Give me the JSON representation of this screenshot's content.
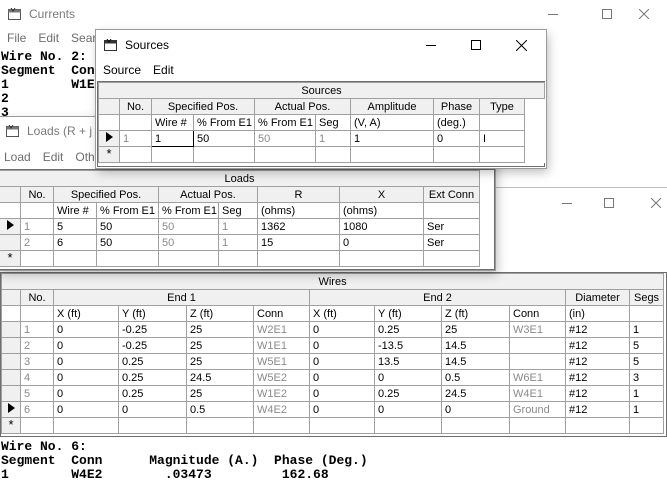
{
  "currents_window": {
    "title": "Currents",
    "menu": [
      "File",
      "Edit",
      "Searc"
    ],
    "lines_top": [
      "Wire No. 2:",
      "Segment  Con",
      "1        W1E",
      "2",
      "3"
    ],
    "lines_bottom": [
      "Wire No. 6:",
      "Segment  Conn      Magnitude (A.)  Phase (Deg.)",
      "1        W4E2        .03473         162.68"
    ]
  },
  "sources_window": {
    "title": "Sources",
    "menu": [
      "Source",
      "Edit"
    ],
    "caption": "Sources",
    "headers": {
      "no": "No.",
      "specified": "Specified Pos.",
      "actual": "Actual Pos.",
      "amplitude": "Amplitude",
      "phase": "Phase",
      "type": "Type"
    },
    "subheaders": {
      "wire": "Wire #",
      "from1": "% From E1",
      "from2": "% From E1",
      "seg": "Seg",
      "amp_units": "(V, A)",
      "phase_units": "(deg.)"
    },
    "rows": [
      {
        "no": "1",
        "wire": "1",
        "from": "50",
        "afrom": "50",
        "seg": "1",
        "amp": "1",
        "phase": "0",
        "type": "I"
      }
    ],
    "new_row_marker": "*"
  },
  "loads_window": {
    "title": "Loads (R + j X",
    "menu": [
      "Load",
      "Edit",
      "Oth"
    ],
    "caption": "Loads",
    "headers": {
      "no": "No.",
      "specified": "Specified Pos.",
      "actual": "Actual Pos.",
      "r": "R",
      "x": "X",
      "ext": "Ext Conn"
    },
    "subheaders": {
      "wire": "Wire #",
      "from1": "% From E1",
      "from2": "% From E1",
      "seg": "Seg",
      "r_units": "(ohms)",
      "x_units": "(ohms)"
    },
    "rows": [
      {
        "no": "1",
        "wire": "5",
        "from": "50",
        "afrom": "50",
        "seg": "1",
        "r": "1362",
        "x": "1080",
        "ext": "Ser"
      },
      {
        "no": "2",
        "wire": "6",
        "from": "50",
        "afrom": "50",
        "seg": "1",
        "r": "15",
        "x": "0",
        "ext": "Ser"
      }
    ],
    "new_row_marker": "*"
  },
  "wires_window": {
    "caption": "Wires",
    "headers": {
      "no": "No.",
      "end1": "End 1",
      "end2": "End 2",
      "diameter": "Diameter",
      "segs": "Segs"
    },
    "subheaders": {
      "x1": "X  (ft)",
      "y1": "Y  (ft)",
      "z1": "Z  (ft)",
      "conn1": "Conn",
      "x2": "X  (ft)",
      "y2": "Y  (ft)",
      "z2": "Z  (ft)",
      "conn2": "Conn",
      "dia_units": "(in)"
    },
    "rows": [
      {
        "no": "1",
        "x1": "0",
        "y1": "-0.25",
        "z1": "25",
        "c1": "W2E1",
        "x2": "0",
        "y2": "0.25",
        "z2": "25",
        "c2": "W3E1",
        "dia": "#12",
        "segs": "1"
      },
      {
        "no": "2",
        "x1": "0",
        "y1": "-0.25",
        "z1": "25",
        "c1": "W1E1",
        "x2": "0",
        "y2": "-13.5",
        "z2": "14.5",
        "c2": "",
        "dia": "#12",
        "segs": "5"
      },
      {
        "no": "3",
        "x1": "0",
        "y1": "0.25",
        "z1": "25",
        "c1": "W5E1",
        "x2": "0",
        "y2": "13.5",
        "z2": "14.5",
        "c2": "",
        "dia": "#12",
        "segs": "5"
      },
      {
        "no": "4",
        "x1": "0",
        "y1": "0.25",
        "z1": "24.5",
        "c1": "W5E2",
        "x2": "0",
        "y2": "0",
        "z2": "0.5",
        "c2": "W6E1",
        "dia": "#12",
        "segs": "3"
      },
      {
        "no": "5",
        "x1": "0",
        "y1": "0.25",
        "z1": "25",
        "c1": "W1E2",
        "x2": "0",
        "y2": "0.25",
        "z2": "24.5",
        "c2": "W4E1",
        "dia": "#12",
        "segs": "1"
      },
      {
        "no": "6",
        "x1": "0",
        "y1": "0",
        "z1": "0.5",
        "c1": "W4E2",
        "x2": "0",
        "y2": "0",
        "z2": "0",
        "c2": "Ground",
        "dia": "#12",
        "segs": "1"
      }
    ],
    "new_row_marker": "*"
  }
}
